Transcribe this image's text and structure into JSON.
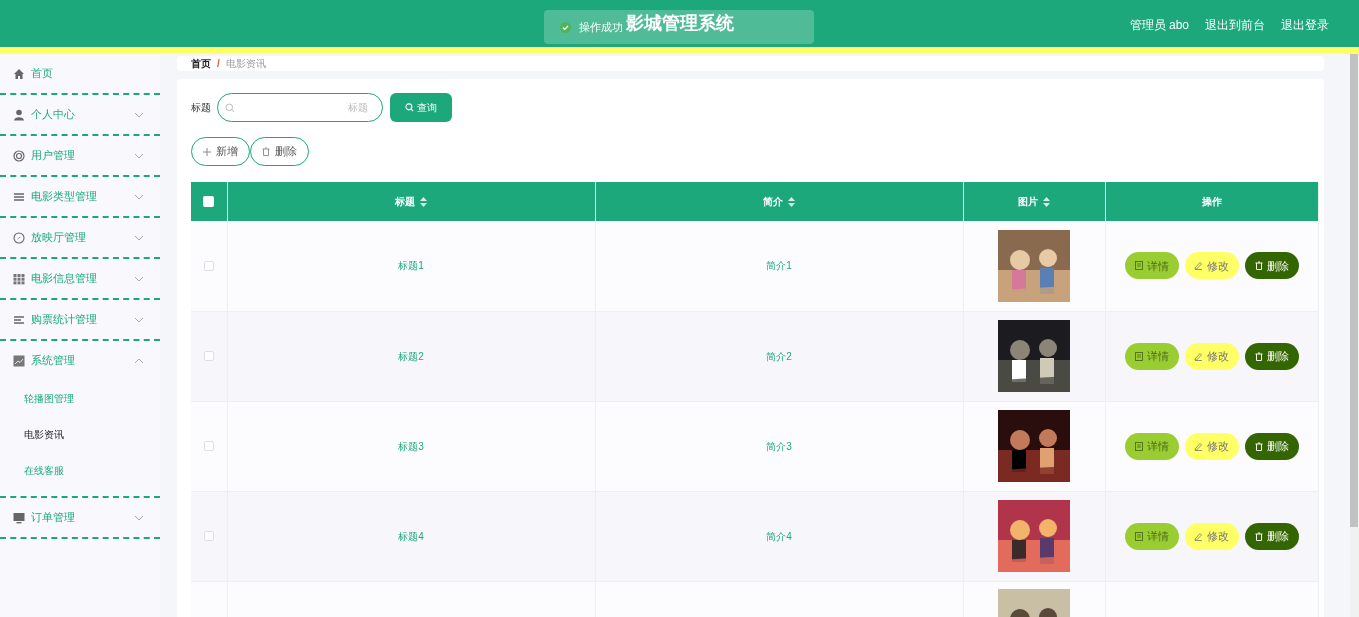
{
  "header": {
    "title": "影城管理系统",
    "user": "管理员 abo",
    "links": [
      "退出到前台",
      "退出登录"
    ]
  },
  "toast": {
    "message": "操作成功"
  },
  "sidebar": {
    "items": [
      {
        "label": "首页",
        "has_children": false
      },
      {
        "label": "个人中心",
        "expanded": false,
        "has_children": true
      },
      {
        "label": "用户管理",
        "expanded": false,
        "has_children": true
      },
      {
        "label": "电影类型管理",
        "expanded": false,
        "has_children": true
      },
      {
        "label": "放映厅管理",
        "expanded": false,
        "has_children": true
      },
      {
        "label": "电影信息管理",
        "expanded": false,
        "has_children": true
      },
      {
        "label": "购票统计管理",
        "expanded": false,
        "has_children": true
      },
      {
        "label": "系统管理",
        "expanded": true,
        "has_children": true,
        "children": [
          {
            "label": "轮播图管理",
            "selected": false
          },
          {
            "label": "电影资讯",
            "selected": true
          },
          {
            "label": "在线客服",
            "selected": false
          }
        ]
      },
      {
        "label": "订单管理",
        "expanded": false,
        "has_children": true
      }
    ]
  },
  "breadcrumb": {
    "separator": "/",
    "items": [
      "首页",
      "电影资讯"
    ]
  },
  "search": {
    "label": "标题",
    "placeholder": "标题",
    "button": "查询"
  },
  "actions": [
    {
      "label": "新增",
      "kind": "add"
    },
    {
      "label": "删除",
      "kind": "delete"
    }
  ],
  "table": {
    "columns": [
      {
        "label": "标题",
        "sortable": true
      },
      {
        "label": "简介",
        "sortable": true
      },
      {
        "label": "图片",
        "sortable": true
      },
      {
        "label": "操作",
        "sortable": false
      }
    ],
    "header_checked": false,
    "rows": [
      {
        "title": "标题1",
        "intro": "简介1",
        "checked": false,
        "image": {
          "kind": "picture"
        },
        "buttons": [
          {
            "label": "详情",
            "kind": "detail"
          },
          {
            "label": "修改",
            "kind": "edit"
          },
          {
            "label": "删除",
            "kind": "delete"
          }
        ]
      },
      {
        "title": "标题2",
        "intro": "简介2",
        "checked": false,
        "image": {
          "kind": "picture"
        },
        "buttons": [
          {
            "label": "详情",
            "kind": "detail"
          },
          {
            "label": "修改",
            "kind": "edit"
          },
          {
            "label": "删除",
            "kind": "delete"
          }
        ]
      },
      {
        "title": "标题3",
        "intro": "简介3",
        "checked": false,
        "image": {
          "kind": "picture"
        },
        "buttons": [
          {
            "label": "详情",
            "kind": "detail"
          },
          {
            "label": "修改",
            "kind": "edit"
          },
          {
            "label": "删除",
            "kind": "delete"
          }
        ]
      },
      {
        "title": "标题4",
        "intro": "简介4",
        "checked": false,
        "image": {
          "kind": "picture"
        },
        "buttons": [
          {
            "label": "详情",
            "kind": "detail"
          },
          {
            "label": "修改",
            "kind": "edit"
          },
          {
            "label": "删除",
            "kind": "delete"
          }
        ]
      },
      {
        "image": {
          "kind": "picture"
        }
      }
    ]
  }
}
